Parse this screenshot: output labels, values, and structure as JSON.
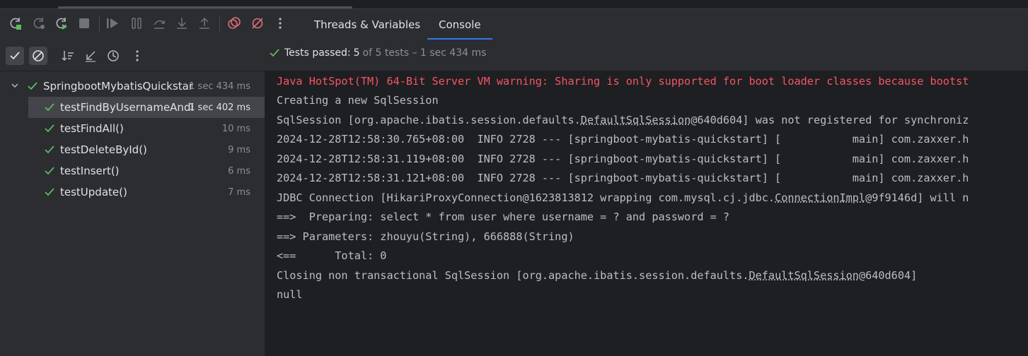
{
  "colors": {
    "accent": "#3574f0",
    "pass": "#5fb865",
    "error": "#f75464",
    "stop": "#e06c75"
  },
  "tabs": [
    {
      "label": "Threads & Variables",
      "active": false
    },
    {
      "label": "Console",
      "active": true
    }
  ],
  "toolbar_icons": [
    "rerun-icon",
    "rerun-failed-icon",
    "debug-rerun-icon",
    "stop-icon",
    "resume-icon",
    "pause-icon",
    "step-over-icon",
    "step-into-icon",
    "step-out-icon",
    "view-breakpoints-icon",
    "mute-breakpoints-icon",
    "more-icon"
  ],
  "filter_icons": [
    "show-passed-icon",
    "show-ignored-icon",
    "sort-icon",
    "collapse-icon",
    "sort-by-duration-icon",
    "more-icon"
  ],
  "status": {
    "label": "Tests passed:",
    "passed": "5",
    "rest": "of 5 tests – 1 sec 434 ms"
  },
  "tree": {
    "root": {
      "label": "SpringbootMybatisQuickstar",
      "duration": "1 sec 434 ms"
    },
    "tests": [
      {
        "label": "testFindByUsernameAndF",
        "duration": "1 sec 402 ms"
      },
      {
        "label": "testFindAll()",
        "duration": "10 ms"
      },
      {
        "label": "testDeleteById()",
        "duration": "9 ms"
      },
      {
        "label": "testInsert()",
        "duration": "6 ms"
      },
      {
        "label": "testUpdate()",
        "duration": "7 ms"
      }
    ]
  },
  "console": {
    "l0": "Java HotSpot(TM) 64-Bit Server VM warning: Sharing is only supported for boot loader classes because bootst",
    "l1": "Creating a new SqlSession",
    "l2a": "SqlSession [org.apache.ibatis.session.defaults.",
    "l2b": "DefaultSqlSession",
    "l2c": "@640d604] was not registered for synchroniz",
    "l3": "2024-12-28T12:58:30.765+08:00  INFO 2728 --- [springboot-mybatis-quickstart] [           main] com.zaxxer.h",
    "l4": "2024-12-28T12:58:31.119+08:00  INFO 2728 --- [springboot-mybatis-quickstart] [           main] com.zaxxer.h",
    "l5": "2024-12-28T12:58:31.121+08:00  INFO 2728 --- [springboot-mybatis-quickstart] [           main] com.zaxxer.h",
    "l6a": "JDBC Connection [HikariProxyConnection@1623813812 wrapping com.mysql.cj.jdbc.",
    "l6b": "ConnectionImpl",
    "l6c": "@9f9146d] will n",
    "l7": "==>  Preparing: select * from user where username = ? and password = ?",
    "l8": "==> Parameters: zhouyu(String), 666888(String)",
    "l9": "<==      Total: 0",
    "l10a": "Closing non transactional SqlSession [org.apache.ibatis.session.defaults.",
    "l10b": "DefaultSqlSession",
    "l10c": "@640d604]",
    "l11": "null"
  }
}
